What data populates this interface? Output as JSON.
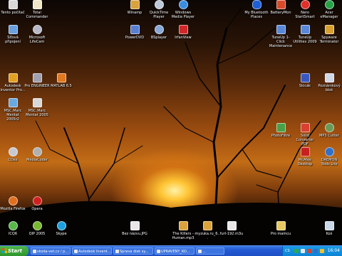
{
  "desktop": {
    "icons": [
      {
        "label": "Tento počítač",
        "icon": "computer-icon",
        "color": "#d8d8d8"
      },
      {
        "label": "Total Commander",
        "icon": "floppy-icon",
        "color": "#f0e6c8"
      },
      {
        "label": "Winamp",
        "icon": "winamp-icon",
        "color": "#d9a23c"
      },
      {
        "label": "QuickTime Player",
        "icon": "quicktime-icon",
        "color": "#bfc8d8"
      },
      {
        "label": "Windows Media Player",
        "icon": "media-player-icon",
        "color": "#3a8ee0"
      },
      {
        "label": "My Bluetooth Places",
        "icon": "bluetooth-icon",
        "color": "#1e5fd6"
      },
      {
        "label": "BatteryMon",
        "icon": "battery-icon",
        "color": "#d84a2a"
      },
      {
        "label": "Nero StartSmart",
        "icon": "nero-icon",
        "color": "#e0302a"
      },
      {
        "label": "Acer eManager",
        "icon": "emanager-icon",
        "color": "#28a048"
      },
      {
        "label": "Síťová připojení",
        "icon": "network-icon",
        "color": "#6aa0e0"
      },
      {
        "label": "Microsoft LifeCam",
        "icon": "webcam-icon",
        "color": "#b8b8c8"
      },
      {
        "label": "PowerDVD",
        "icon": "powerdvd-icon",
        "color": "#5a7fd0"
      },
      {
        "label": "BSplayer",
        "icon": "bsplayer-icon",
        "color": "#88a8d8"
      },
      {
        "label": "IrfanView",
        "icon": "irfanview-icon",
        "color": "#d02828"
      },
      {
        "label": "TuneUp 1-Click Maintenance",
        "icon": "tuneup-icon",
        "color": "#5a88d8"
      },
      {
        "label": "TuneUp Utilities 2009",
        "icon": "tuneup-utilities-icon",
        "color": "#5a88d8"
      },
      {
        "label": "Spyware Terminator",
        "icon": "shield-icon",
        "color": "#d8a030"
      },
      {
        "label": "Autodesk Inventor Pro...",
        "icon": "inventor-icon",
        "color": "#e0a020"
      },
      {
        "label": "Pro ENGINEER",
        "icon": "proengineer-icon",
        "color": "#a0a0b0"
      },
      {
        "label": "MATLAB 6.5",
        "icon": "matlab-icon",
        "color": "#e07820"
      },
      {
        "label": "Skicák",
        "icon": "paint-icon",
        "color": "#3858c0"
      },
      {
        "label": "Poznámkový blok",
        "icon": "notepad-icon",
        "color": "#d0d8e8"
      },
      {
        "label": "MSC.Marc Mentat 2005r2",
        "icon": "msc-marc-icon",
        "color": "#6aa8e0"
      },
      {
        "label": "MSC.Marc Mentat 2005",
        "icon": "msc-marc-icon",
        "color": "#d8d8d8"
      },
      {
        "label": "PhotoFiltre",
        "icon": "photofiltre-icon",
        "color": "#48a048"
      },
      {
        "label": "Solid Converter PDF",
        "icon": "pdf-converter-icon",
        "color": "#d84030"
      },
      {
        "label": "MP3 Cutter",
        "icon": "mp3-cutter-icon",
        "color": "#6a9a58"
      },
      {
        "label": "CDex",
        "icon": "cd-icon",
        "color": "#c8c8d0"
      },
      {
        "label": "MediaCoder",
        "icon": "mediacoder-icon",
        "color": "#b0b0b0"
      },
      {
        "label": "McAfee Desktop",
        "icon": "mcafee-icon",
        "color": "#c82020"
      },
      {
        "label": "DAEMON Tools Lite",
        "icon": "daemon-tools-icon",
        "color": "#3070c8"
      },
      {
        "label": "Mozilla Firefox",
        "icon": "firefox-icon",
        "color": "#e07020"
      },
      {
        "label": "Opera",
        "icon": "opera-icon",
        "color": "#d02020"
      },
      {
        "label": "ICQ6",
        "icon": "icq-icon",
        "color": "#58b848"
      },
      {
        "label": "QIP 2005",
        "icon": "qip-icon",
        "color": "#78b830"
      },
      {
        "label": "Skype",
        "icon": "skype-icon",
        "color": "#1ea0e0"
      },
      {
        "label": "Bez názvu.JPG",
        "icon": "image-file-icon",
        "color": "#e8e8e8"
      },
      {
        "label": "The Killers - Human.mp3",
        "icon": "mp3-file-icon",
        "color": "#d9a23c"
      },
      {
        "label": "myzuka.ru_6...",
        "icon": "mp3-file-icon",
        "color": "#d9a23c"
      },
      {
        "label": "furl-192.m3u",
        "icon": "playlist-file-icon",
        "color": "#e8e8e8"
      },
      {
        "label": "Pro mamcu",
        "icon": "folder-icon",
        "color": "#e8c860"
      },
      {
        "label": "Koš",
        "icon": "recycle-bin-icon",
        "color": "#c8d8e8"
      }
    ]
  },
  "taskbar": {
    "start_label": "Start",
    "tasks": [
      {
        "label": "skoda-vet.cz / p..."
      },
      {
        "label": "Autodesk Invent..."
      },
      {
        "label": "Sprava disk sy..."
      },
      {
        "label": "UPRAVENY_KO..."
      },
      {
        "label": "..."
      }
    ],
    "tray": {
      "lang": "CS",
      "clock": "16:04"
    }
  },
  "colors": {
    "taskbar": "#2459d4",
    "start_button": "#2f952c",
    "tray": "#0d84d6"
  }
}
